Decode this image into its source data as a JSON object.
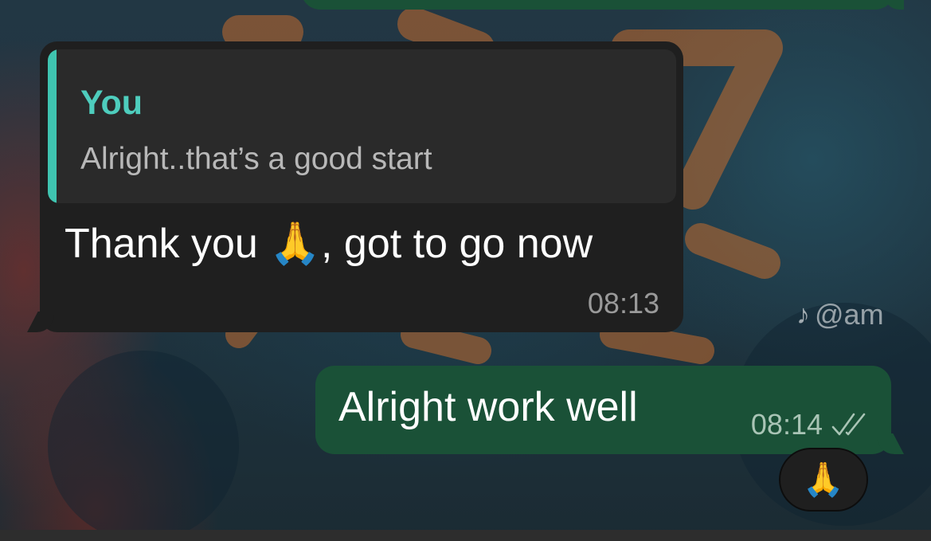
{
  "watermark": {
    "icon": "tiktok-icon",
    "glyph": "♪",
    "handle": "@am"
  },
  "messages": {
    "incoming": {
      "quote": {
        "author": "You",
        "text": "Alright..that’s a good start"
      },
      "text": "Thank you 🙏, got to go now",
      "time": "08:13"
    },
    "outgoing": {
      "text": "Alright work well",
      "time": "08:14",
      "status_icon": "double-check-icon"
    },
    "reaction": {
      "emoji": "🙏"
    }
  },
  "colors": {
    "incoming_bubble": "#1f1f1f",
    "outgoing_bubble": "#1a5137",
    "quote_accent": "#3fc4b0"
  }
}
